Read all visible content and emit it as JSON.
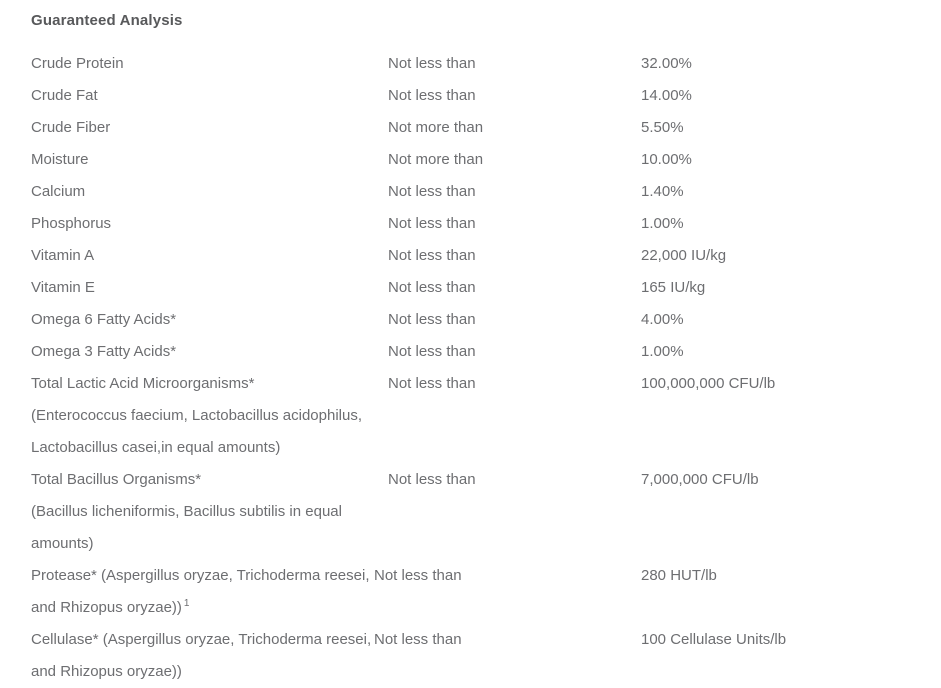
{
  "section": {
    "heading": "Guaranteed Analysis"
  },
  "rows": [
    {
      "nutrient": "Crude Protein",
      "qualifier": "Not less than",
      "value": "32.00%"
    },
    {
      "nutrient": "Crude Fat",
      "qualifier": "Not less than",
      "value": "14.00%"
    },
    {
      "nutrient": "Crude Fiber",
      "qualifier": "Not more than",
      "value": "5.50%"
    },
    {
      "nutrient": "Moisture",
      "qualifier": "Not more than",
      "value": "10.00%"
    },
    {
      "nutrient": "Calcium",
      "qualifier": "Not less than",
      "value": "1.40%"
    },
    {
      "nutrient": "Phosphorus",
      "qualifier": "Not less than",
      "value": "1.00%"
    },
    {
      "nutrient": "Vitamin A",
      "qualifier": "Not less than",
      "value": "22,000 IU/kg"
    },
    {
      "nutrient": "Vitamin E",
      "qualifier": "Not less than",
      "value": "165 IU/kg"
    },
    {
      "nutrient": "Omega 6 Fatty Acids*",
      "qualifier": "Not less than",
      "value": "4.00%"
    },
    {
      "nutrient": "Omega 3 Fatty Acids*",
      "qualifier": "Not less than",
      "value": "1.00%"
    },
    {
      "nutrient": "Total Lactic Acid Microorganisms*",
      "qualifier": "Not less than",
      "value": "100,000,000 CFU/lb"
    },
    {
      "nutrient": "(Enterococcus faecium, Lactobacillus acidophilus, Lactobacillus casei,in equal amounts)",
      "qualifier": "",
      "value": ""
    },
    {
      "nutrient": "Total Bacillus Organisms*",
      "qualifier": "Not less than",
      "value": "7,000,000 CFU/lb"
    },
    {
      "nutrient": "(Bacillus licheniformis, Bacillus subtilis in equal amounts)",
      "qualifier": "",
      "value": ""
    },
    {
      "nutrient": "Protease* (Aspergillus oryzae, Trichoderma reesei, and Rhizopus oryzae))",
      "footnote": "1",
      "qualifier": "Not less than",
      "value": "280 HUT/lb"
    },
    {
      "nutrient": "Cellulase* (Aspergillus oryzae, Trichoderma reesei, and Rhizopus oryzae))",
      "qualifier": "Not less than",
      "value": "100 Cellulase Units/lb"
    }
  ],
  "colors": {
    "background": "#ffffff",
    "heading_text": "#58595b",
    "body_text": "#6d6e71"
  }
}
